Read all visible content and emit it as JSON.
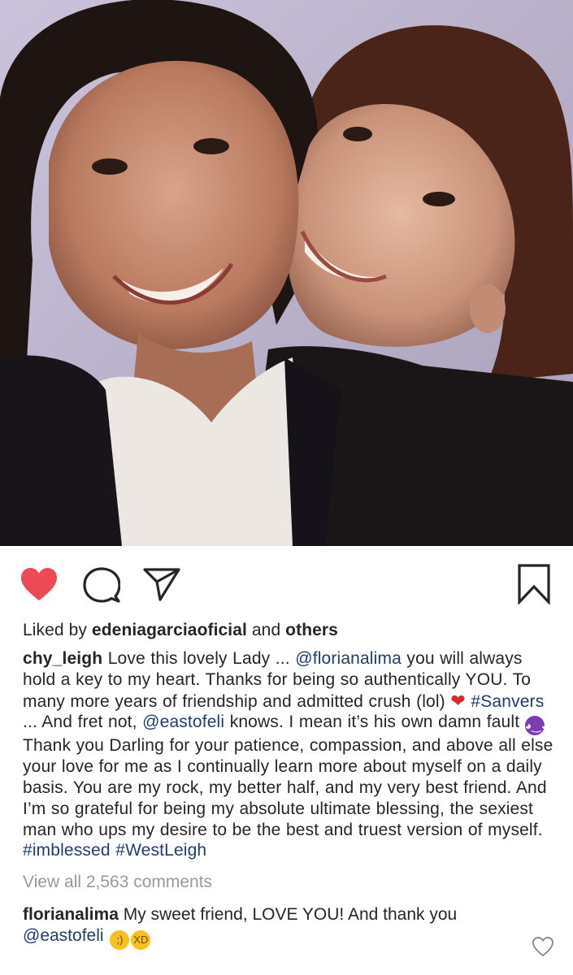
{
  "post": {
    "likes": {
      "prefix": "Liked by",
      "user": "edeniagarciaoficial",
      "joiner": "and",
      "others": "others"
    },
    "caption": {
      "author": "chy_leigh",
      "t1": "Love this lovely Lady ...",
      "m1": "@florianalima",
      "t2": "you will always hold a key to my heart. Thanks for being so authentically YOU. To many more  years of friendship and admitted crush (lol)",
      "h1": "#Sanvers",
      "t3": "... And fret not,",
      "m2": "@eastofeli",
      "t4": "knows. I mean it’s his own damn fault",
      "t5": "Thank you Darling for your patience, compassion, and above all else your love for me as I continually learn more about myself on a daily basis. You are my rock, my better half, and my very best friend. And I’m so grateful for being my absolute ultimate blessing, the sexiest man who ups my desire to be the best and truest version of myself.",
      "h2": "#imblessed",
      "h3": "#WestLeigh"
    },
    "view_all_comments": "View all 2,563 comments",
    "top_comment": {
      "author": "florianalima",
      "text": "My sweet friend, LOVE YOU! And thank you",
      "mention": "@eastofeli"
    }
  },
  "icons": {
    "like": "heart-filled-icon",
    "comment": "comment-bubble-icon",
    "share": "paper-plane-icon",
    "save": "bookmark-icon",
    "comment_like": "heart-outline-icon"
  },
  "colors": {
    "like_red": "#ed4956",
    "mention_blue": "#1f3e6e",
    "muted_gray": "#999999",
    "text": "#262626"
  }
}
